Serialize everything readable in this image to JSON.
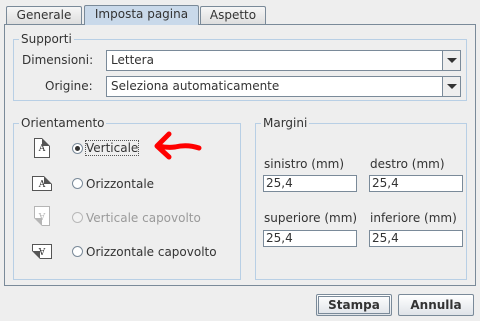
{
  "tabs": [
    {
      "label": "Generale",
      "active": false
    },
    {
      "label": "Imposta pagina",
      "active": true
    },
    {
      "label": "Aspetto",
      "active": false
    }
  ],
  "supporti": {
    "title": "Supporti",
    "dimensioni_label": "Dimensioni:",
    "dimensioni_value": "Lettera",
    "origine_label": "Origine:",
    "origine_value": "Seleziona automaticamente"
  },
  "orientamento": {
    "title": "Orientamento",
    "options": [
      {
        "label": "Verticale",
        "selected": true,
        "enabled": true,
        "icon": "portrait-page-icon"
      },
      {
        "label": "Orizzontale",
        "selected": false,
        "enabled": true,
        "icon": "landscape-page-icon"
      },
      {
        "label": "Verticale capovolto",
        "selected": false,
        "enabled": false,
        "icon": "reverse-portrait-page-icon"
      },
      {
        "label": "Orizzontale capovolto",
        "selected": false,
        "enabled": true,
        "icon": "reverse-landscape-page-icon"
      }
    ],
    "icon_letter": "A"
  },
  "margini": {
    "title": "Margini",
    "sinistro_label": "sinistro (mm)",
    "sinistro_value": "25,4",
    "destro_label": "destro (mm)",
    "destro_value": "25,4",
    "superiore_label": "superiore (mm)",
    "superiore_value": "25,4",
    "inferiore_label": "inferiore (mm)",
    "inferiore_value": "25,4"
  },
  "buttons": {
    "stampa": "Stampa",
    "annulla": "Annulla"
  },
  "colors": {
    "accent_arrow": "#ff0000",
    "active_tab": "#c9d9ea",
    "group_border": "#b8cfe5"
  }
}
